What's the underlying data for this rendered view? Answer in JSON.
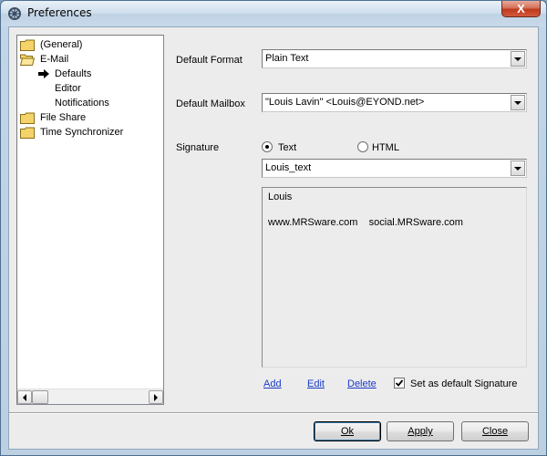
{
  "window": {
    "title": "Preferences",
    "close_glyph": "X"
  },
  "tree": {
    "items": [
      {
        "label": "(General)",
        "icon": "folder-icon"
      },
      {
        "label": "E-Mail",
        "icon": "folder-open-icon"
      },
      {
        "label": "Defaults",
        "icon": "arrow-right-icon",
        "selected": true
      },
      {
        "label": "Editor"
      },
      {
        "label": "Notifications"
      },
      {
        "label": "File Share",
        "icon": "folder-icon"
      },
      {
        "label": "Time Synchronizer",
        "icon": "folder-icon"
      }
    ]
  },
  "form": {
    "default_format_label": "Default Format",
    "default_format_value": "Plain Text",
    "default_mailbox_label": "Default Mailbox",
    "default_mailbox_value": "\"Louis Lavin\" <Louis@EYOND.net>",
    "signature_label": "Signature",
    "radio_text_label": "Text",
    "radio_html_label": "HTML",
    "signature_name_value": "Louis_text",
    "signature_body": {
      "line1": "Louis",
      "line2": "www.MRSware.com    social.MRSware.com"
    },
    "add_link": "Add",
    "edit_link": "Edit",
    "delete_link": "Delete",
    "set_default_label": "Set as default Signature",
    "set_default_checked": true
  },
  "buttons": {
    "ok": "Ok",
    "apply": "Apply",
    "close": "Close"
  },
  "colors": {
    "link": "#1a3cc8",
    "close_button": "#c0391b",
    "folder": "#f3d36a"
  }
}
